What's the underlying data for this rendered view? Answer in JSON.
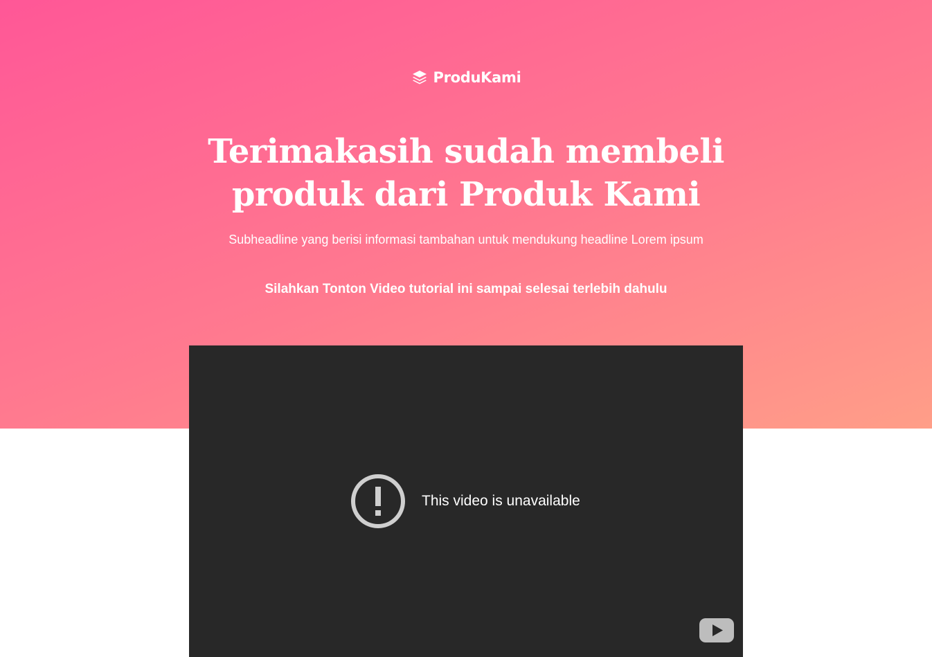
{
  "brand": {
    "name": "ProduKami",
    "icon": "layers-icon"
  },
  "hero": {
    "headline": "Terimakasih sudah membeli produk dari Produk Kami",
    "subheadline": "Subheadline yang berisi informasi tambahan untuk mendukung headline Lorem ipsum",
    "instruction": "Silahkan Tonton Video tutorial ini sampai selesai terlebih dahulu",
    "gradient_start": "#ff5797",
    "gradient_end": "#ff9e88"
  },
  "video": {
    "error_message": "This video is unavailable",
    "error_icon": "alert-circle-icon",
    "player_logo_icon": "youtube-logo-icon",
    "background": "#282828"
  }
}
